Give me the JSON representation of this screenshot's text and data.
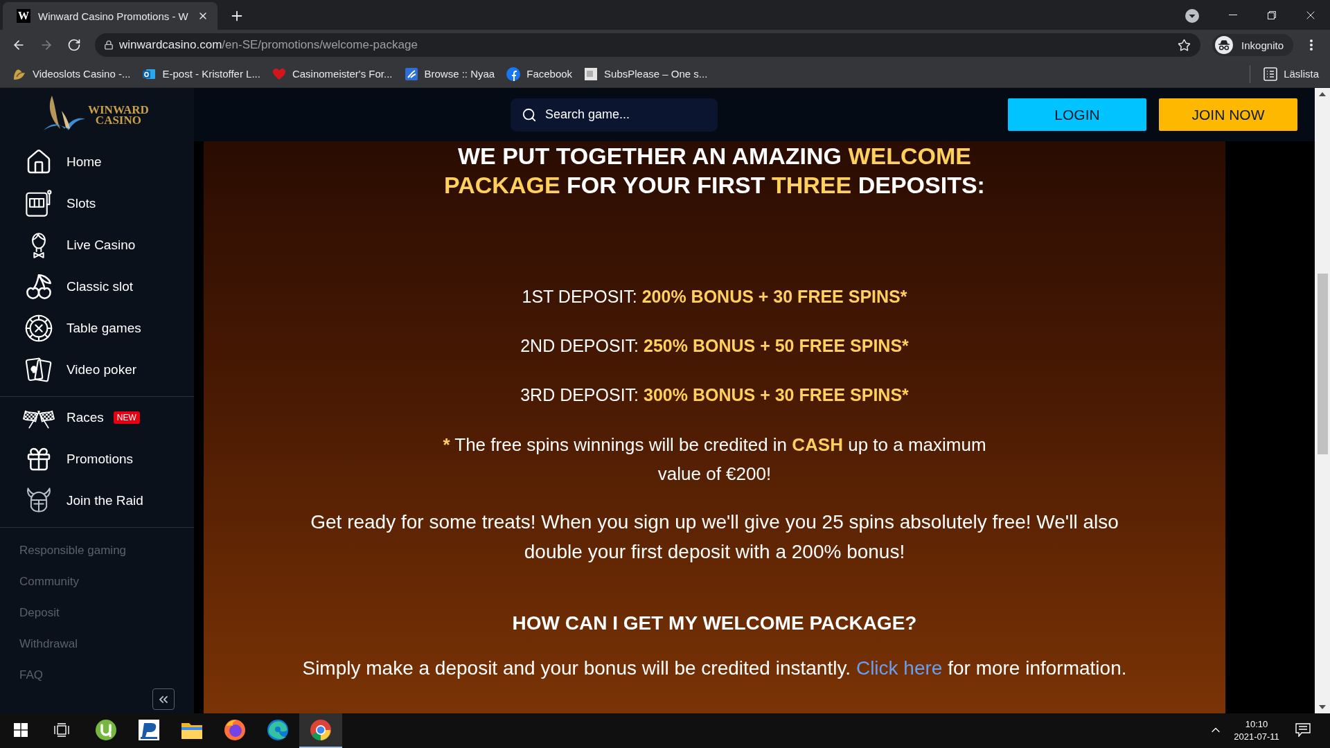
{
  "browser": {
    "tab": {
      "favicon": "W",
      "title": "Winward Casino Promotions - W"
    },
    "nav_buttons": [
      {
        "disabled": false
      },
      {
        "disabled": true
      },
      {
        "disabled": false
      }
    ],
    "url": {
      "host": "winwardcasino.com",
      "path": "/en-SE/promotions/welcome-package"
    },
    "profile": "Inkognito",
    "bookmarks": [
      {
        "label": "Videoslots Casino -..."
      },
      {
        "label": "E-post - Kristoffer L..."
      },
      {
        "label": "Casinomeister's For..."
      },
      {
        "label": "Browse :: Nyaa"
      },
      {
        "label": "Facebook"
      },
      {
        "label": "SubsPlease – One s..."
      }
    ],
    "reading_list": "Läslista"
  },
  "site": {
    "logo": [
      "WINWARD",
      "CASINO"
    ],
    "nav_main": [
      {
        "label": "Home"
      },
      {
        "label": "Slots"
      },
      {
        "label": "Live Casino"
      },
      {
        "label": "Classic slot"
      },
      {
        "label": "Table games"
      },
      {
        "label": "Video poker"
      }
    ],
    "nav_extra": [
      {
        "label": "Races",
        "badge": "NEW"
      },
      {
        "label": "Promotions"
      },
      {
        "label": "Join the Raid"
      }
    ],
    "footer_links": [
      "Responsible gaming",
      "Community",
      "Deposit",
      "Withdrawal",
      "FAQ"
    ],
    "search": {
      "placeholder": "Search game..."
    },
    "buttons": [
      {
        "label": "LOGIN",
        "kind": "login"
      },
      {
        "label": "JOIN NOW",
        "kind": "join"
      }
    ],
    "promo": {
      "heading": [
        {
          "text": "WE PUT TOGETHER AN AMAZING ",
          "highlight": false
        },
        {
          "text": "WELCOME PACKAGE",
          "highlight": true
        },
        {
          "text": " FOR YOUR FIRST ",
          "highlight": false
        },
        {
          "text": "THREE",
          "highlight": true
        },
        {
          "text": " DEPOSITS:",
          "highlight": false
        }
      ],
      "deposits": [
        [
          {
            "text": "1ST DEPOSIT: ",
            "highlight": false
          },
          {
            "text": "200% BONUS + 30 FREE SPINS*",
            "highlight": true
          }
        ],
        [
          {
            "text": "2ND DEPOSIT: ",
            "highlight": false
          },
          {
            "text": "250% BONUS + 50 FREE SPINS*",
            "highlight": true
          }
        ],
        [
          {
            "text": "3RD DEPOSIT: ",
            "highlight": false
          },
          {
            "text": "300% BONUS + 30 FREE SPINS*",
            "highlight": true
          }
        ]
      ],
      "note": [
        {
          "text": "*",
          "highlight": true
        },
        {
          "text": " The free spins winnings will be credited in ",
          "highlight": false
        },
        {
          "text": "CASH",
          "highlight": true
        },
        {
          "text": " up to a maximum value of €200!",
          "highlight": false
        }
      ],
      "intro": "Get ready for some treats! When you sign up we'll give you 25 spins absolutely free! We'll also double your first deposit with a 200% bonus!",
      "subheading": "HOW CAN I GET MY WELCOME PACKAGE?",
      "info": {
        "text_before": "Simply make a deposit and your bonus will be credited instantly. ",
        "link": "Click here",
        "text_after": " for more information."
      }
    }
  },
  "taskbar": {
    "apps": [
      {
        "selected": false
      },
      {
        "selected": false
      },
      {
        "selected": false
      },
      {
        "selected": false
      },
      {
        "selected": false
      },
      {
        "selected": true
      }
    ],
    "time": "10:10",
    "date": "2021-07-11"
  }
}
